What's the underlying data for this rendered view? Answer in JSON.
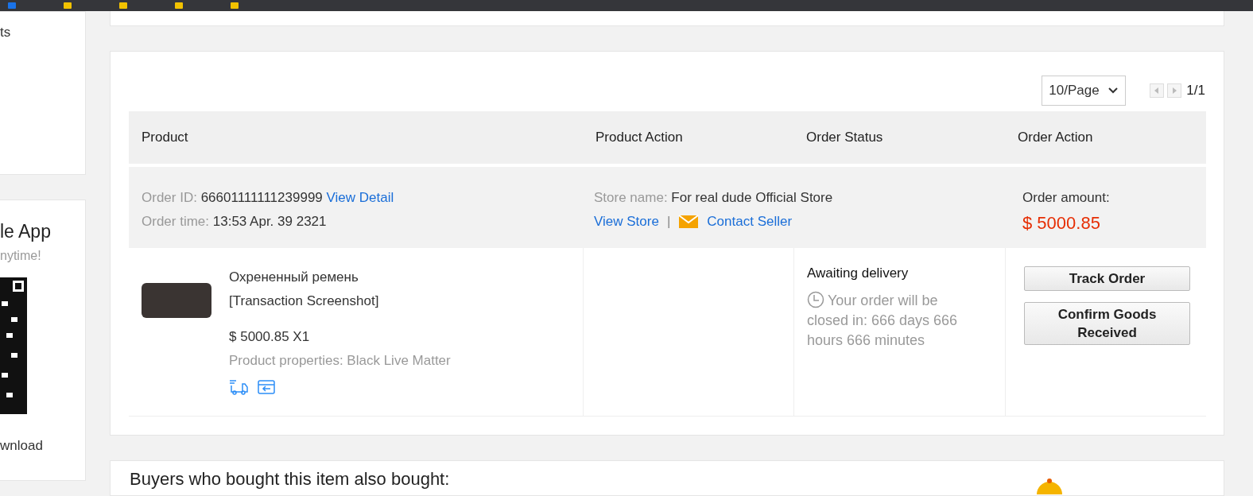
{
  "sidebar": {
    "panels": [
      {
        "kind": "links",
        "texts": [
          "ts"
        ]
      },
      {
        "kind": "app",
        "title": "le App",
        "subtitle": "nytime!",
        "link": "wnload"
      }
    ]
  },
  "pagination": {
    "page_size": "10/Page",
    "page": "1/1"
  },
  "table": {
    "columns": [
      "Product",
      "Product Action",
      "Order Status",
      "Order Action"
    ],
    "orders": [
      {
        "order_id_label": "Order ID:",
        "order_id": "66601111111239999",
        "view_detail": "View Detail",
        "order_time_label": "Order time:",
        "order_time": "13:53 Apr. 39 2321",
        "store_label": "Store name:",
        "store": "For real dude Official Store",
        "view_store": "View Store",
        "separator": "|",
        "contact": "Contact Seller",
        "amount_label": "Order amount:",
        "amount": "$ 5000.85",
        "product": {
          "name": "Охрененный ремень",
          "snapshot": "[Transaction Screenshot]",
          "price": "$ 5000.85 X1",
          "properties": "Product properties: Black Live Matter"
        },
        "status": "Awaiting delivery",
        "countdown": "Your order will be closed in: 666 days 666 hours 666 minutes",
        "actions": [
          "Track Order",
          "Confirm Goods Received"
        ]
      }
    ]
  },
  "recommendations": {
    "title": "Buyers who bought this item also bought:"
  }
}
